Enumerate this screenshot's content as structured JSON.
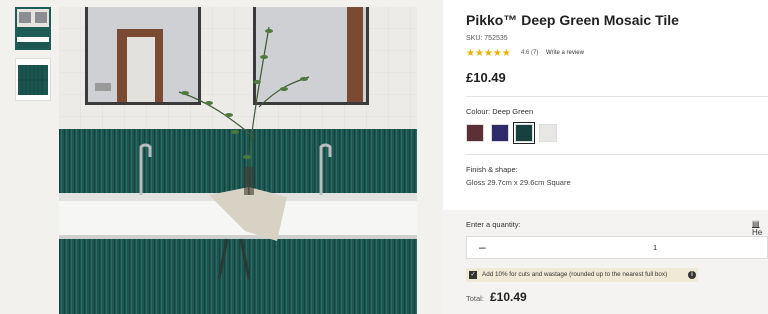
{
  "product": {
    "title": "Pikko™ Deep Green Mosaic Tile",
    "sku": "SKU: 752535",
    "stars": "★★★★★",
    "rating": "4.6 (7)",
    "review_link": "Write a review",
    "price": "£10.49"
  },
  "colour": {
    "label": "Colour: Deep Green",
    "swatches": [
      {
        "name": "burgundy",
        "color": "#5b3137"
      },
      {
        "name": "indigo",
        "color": "#2e2a6b"
      },
      {
        "name": "deep-green",
        "color": "#17413f"
      },
      {
        "name": "white",
        "color": "#e9e7e4"
      }
    ],
    "selected": 2
  },
  "finish": {
    "label": "Finish & shape:",
    "value": "Gloss 29.7cm x 29.6cm Square"
  },
  "quantity": {
    "label": "Enter a quantity:",
    "help": "He",
    "minus": "–",
    "value": "1",
    "wastage_text": "Add 10% for cuts and wastage (rounded up to the nearest full box)",
    "info_icon": "i",
    "check_mark": "✓"
  },
  "total": {
    "label": "Total:",
    "value": "£10.49"
  },
  "colors": {
    "accent": "#1f5c56",
    "tile_green": "#1d5650"
  }
}
